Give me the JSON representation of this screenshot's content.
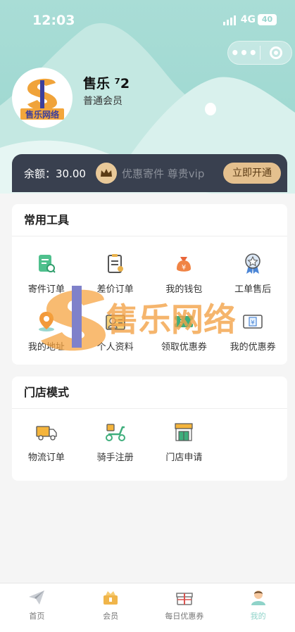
{
  "status": {
    "time": "12:03",
    "network": "4G",
    "battery": "40"
  },
  "user": {
    "name": "售乐 ⁷2",
    "level": "普通会员",
    "avatar_logo_text": "售乐网络"
  },
  "vip": {
    "balance": "余额：30.00",
    "text": "优惠寄件  尊贵vip",
    "button": "立即开通",
    "icon": "crown-icon"
  },
  "tools": {
    "title": "常用工具",
    "items": [
      {
        "label": "寄件订单",
        "icon": "document-search-icon"
      },
      {
        "label": "差价订单",
        "icon": "clipboard-icon"
      },
      {
        "label": "我的钱包",
        "icon": "money-bag-icon"
      },
      {
        "label": "工单售后",
        "icon": "award-badge-icon"
      },
      {
        "label": "我的地址",
        "icon": "map-pin-icon"
      },
      {
        "label": "个人资料",
        "icon": "profile-card-icon"
      },
      {
        "label": "领取优惠券",
        "icon": "ticket-icon"
      },
      {
        "label": "我的优惠券",
        "icon": "coupon-icon"
      }
    ]
  },
  "store": {
    "title": "门店模式",
    "items": [
      {
        "label": "物流订单",
        "icon": "truck-icon"
      },
      {
        "label": "骑手注册",
        "icon": "scooter-icon"
      },
      {
        "label": "门店申请",
        "icon": "store-icon"
      }
    ]
  },
  "watermark": {
    "text": "售乐网络"
  },
  "tabbar": [
    {
      "label": "首页",
      "icon": "paper-plane-icon"
    },
    {
      "label": "会员",
      "icon": "member-icon"
    },
    {
      "label": "每日优惠券",
      "icon": "gift-icon"
    },
    {
      "label": "我的",
      "icon": "user-icon"
    }
  ],
  "colors": {
    "header": "#9ad6cf",
    "vip_bar": "#39404f",
    "vip_button": "#e4c08e",
    "active_tab": "#8fd3c9"
  }
}
